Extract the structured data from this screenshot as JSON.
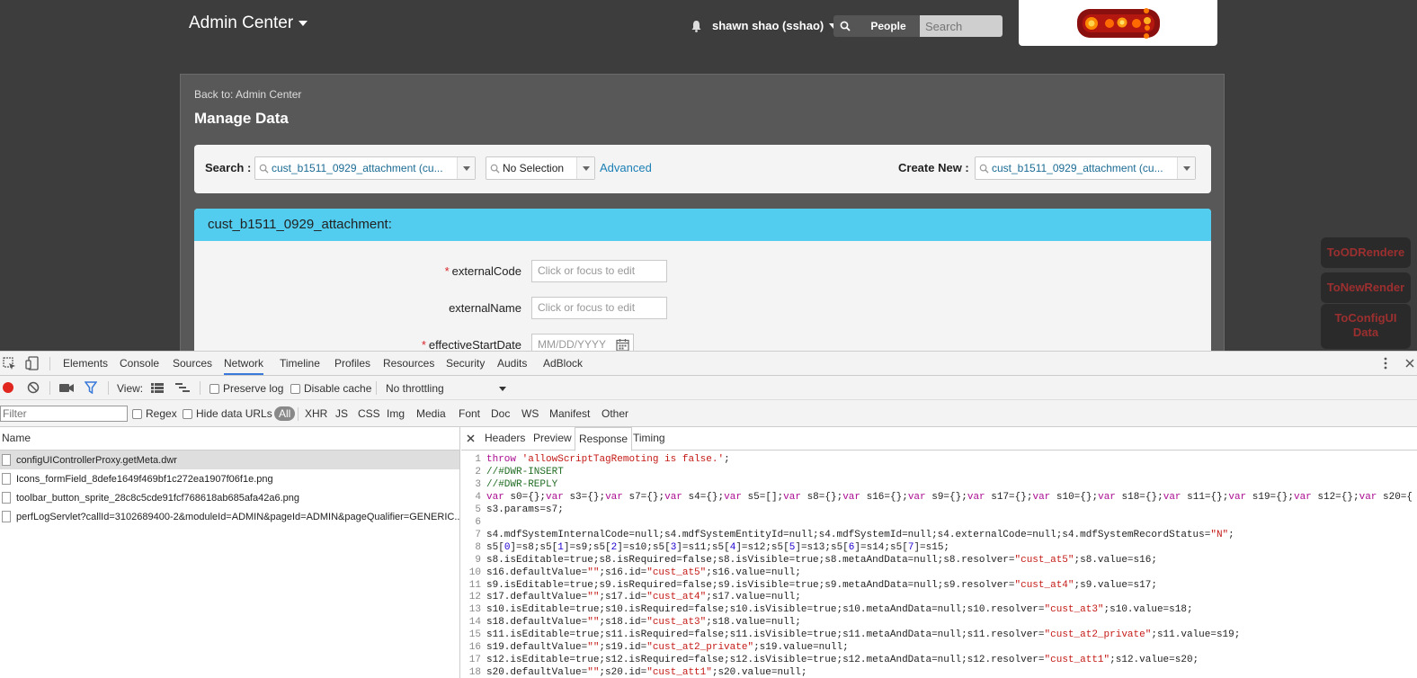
{
  "header": {
    "app_title": "Admin Center",
    "user_name": "shawn shao (sshao)",
    "people_label": "People",
    "search_placeholder": "Search"
  },
  "page": {
    "back_link": "Back to: Admin Center",
    "title": "Manage Data",
    "search_label": "Search :",
    "search_value": "cust_b1511_0929_attachment (cu...",
    "selection_value": "No Selection",
    "advanced_label": "Advanced",
    "create_new_label": "Create New :",
    "create_new_value": "cust_b1511_0929_attachment (cu..."
  },
  "form": {
    "header": "cust_b1511_0929_attachment:",
    "fields": [
      {
        "label": "externalCode",
        "required": "*",
        "placeholder": "Click or focus to edit"
      },
      {
        "label": "externalName",
        "required": "",
        "placeholder": "Click or focus to edit"
      },
      {
        "label": "effectiveStartDate",
        "required": "*",
        "placeholder": "MM/DD/YYYY"
      }
    ]
  },
  "side_buttons": [
    "ToODRendere",
    "ToNewRender",
    "ToConfigUI Data"
  ],
  "devtools": {
    "tabs": [
      "Elements",
      "Console",
      "Sources",
      "Network",
      "Timeline",
      "Profiles",
      "Resources",
      "Security",
      "Audits",
      "AdBlock"
    ],
    "active_tab": "Network",
    "toolbar": {
      "view_label": "View:",
      "preserve_log": "Preserve log",
      "disable_cache": "Disable cache",
      "throttling": "No throttling"
    },
    "filter": {
      "placeholder": "Filter",
      "regex": "Regex",
      "hide_data_urls": "Hide data URLs",
      "types": [
        "All",
        "XHR",
        "JS",
        "CSS",
        "Img",
        "Media",
        "Font",
        "Doc",
        "WS",
        "Manifest",
        "Other"
      ]
    },
    "list_header": "Name",
    "requests": [
      "configUIControllerProxy.getMeta.dwr",
      "Icons_formField_8defe1649f469bf1c272ea1907f06f1e.png",
      "toolbar_button_sprite_28c8c5cde91fcf768618ab685afa42a6.png",
      "perfLogServlet?callId=3102689400-2&moduleId=ADMIN&pageId=ADMIN&pageQualifier=GENERIC..."
    ],
    "detail_tabs": [
      "Headers",
      "Preview",
      "Response",
      "Timing"
    ],
    "active_detail_tab": "Response",
    "code_lines": [
      "throw 'allowScriptTagRemoting is false.';",
      "//#DWR-INSERT",
      "//#DWR-REPLY",
      "var s0={};var s3={};var s7={};var s4={};var s5=[];var s8={};var s16={};var s9={};var s17={};var s10={};var s18={};var s11={};var s19={};var s12={};var s20={",
      "s3.params=s7;",
      "",
      "s4.mdfSystemInternalCode=null;s4.mdfSystemEntityId=null;s4.mdfSystemId=null;s4.externalCode=null;s4.mdfSystemRecordStatus=\"N\";",
      "s5[0]=s8;s5[1]=s9;s5[2]=s10;s5[3]=s11;s5[4]=s12;s5[5]=s13;s5[6]=s14;s5[7]=s15;",
      "s8.isEditable=true;s8.isRequired=false;s8.isVisible=true;s8.metaAndData=null;s8.resolver=\"cust_at5\";s8.value=s16;",
      "s16.defaultValue=\"\";s16.id=\"cust_at5\";s16.value=null;",
      "s9.isEditable=true;s9.isRequired=false;s9.isVisible=true;s9.metaAndData=null;s9.resolver=\"cust_at4\";s9.value=s17;",
      "s17.defaultValue=\"\";s17.id=\"cust_at4\";s17.value=null;",
      "s10.isEditable=true;s10.isRequired=false;s10.isVisible=true;s10.metaAndData=null;s10.resolver=\"cust_at3\";s10.value=s18;",
      "s18.defaultValue=\"\";s18.id=\"cust_at3\";s18.value=null;",
      "s11.isEditable=true;s11.isRequired=false;s11.isVisible=true;s11.metaAndData=null;s11.resolver=\"cust_at2_private\";s11.value=s19;",
      "s19.defaultValue=\"\";s19.id=\"cust_at2_private\";s19.value=null;",
      "s12.isEditable=true;s12.isRequired=false;s12.isVisible=true;s12.metaAndData=null;s12.resolver=\"cust_att1\";s12.value=s20;",
      "s20.defaultValue=\"\";s20.id=\"cust_att1\";s20.value=null;"
    ]
  }
}
